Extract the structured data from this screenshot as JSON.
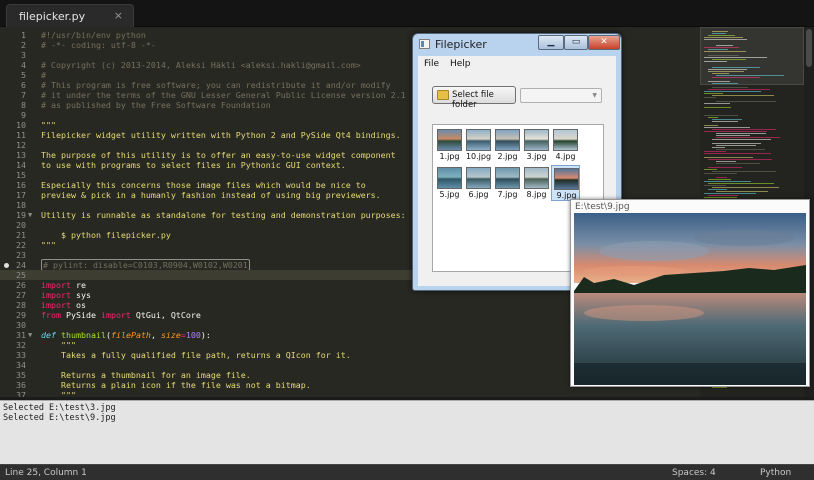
{
  "editor": {
    "tab": {
      "label": "filepicker.py",
      "close": "×"
    },
    "lines": [
      {
        "n": "1",
        "cls": "c-comment",
        "text": "#!/usr/bin/env python"
      },
      {
        "n": "2",
        "cls": "c-comment",
        "text": "# -*- coding: utf-8 -*-"
      },
      {
        "n": "3",
        "cls": "",
        "text": ""
      },
      {
        "n": "4",
        "cls": "c-comment",
        "text": "# Copyright (c) 2013-2014, Aleksi Häkli <aleksi.hakli@gmail.com>"
      },
      {
        "n": "5",
        "cls": "c-comment",
        "text": "#"
      },
      {
        "n": "6",
        "cls": "c-comment",
        "text": "# This program is free software; you can redistribute it and/or modify"
      },
      {
        "n": "7",
        "cls": "c-comment",
        "text": "# it under the terms of the GNU Lesser General Public License version 2.1"
      },
      {
        "n": "8",
        "cls": "c-comment",
        "text": "# as published by the Free Software Foundation"
      },
      {
        "n": "9",
        "cls": "",
        "text": ""
      },
      {
        "n": "10",
        "cls": "c-string",
        "text": "\"\"\""
      },
      {
        "n": "11",
        "cls": "c-string",
        "text": "Filepicker widget utility written with Python 2 and PySide Qt4 bindings."
      },
      {
        "n": "12",
        "cls": "",
        "text": ""
      },
      {
        "n": "13",
        "cls": "c-string",
        "text": "The purpose of this utility is to offer an easy-to-use widget component"
      },
      {
        "n": "14",
        "cls": "c-string",
        "text": "to use with programs to select files in Pythonic GUI context."
      },
      {
        "n": "15",
        "cls": "",
        "text": ""
      },
      {
        "n": "16",
        "cls": "c-string",
        "text": "Especially this concerns those image files which would be nice to"
      },
      {
        "n": "17",
        "cls": "c-string",
        "text": "preview & pick in a humanly fashion instead of using big previewers."
      },
      {
        "n": "18",
        "cls": "",
        "text": ""
      },
      {
        "n": "19",
        "cls": "c-string",
        "fold": "▼",
        "text": "Utility is runnable as standalone for testing and demonstration purposes:"
      },
      {
        "n": "20",
        "cls": "",
        "text": ""
      },
      {
        "n": "21",
        "cls": "c-string",
        "text": "    $ python filepicker.py"
      },
      {
        "n": "22",
        "cls": "c-string",
        "text": "\"\"\""
      },
      {
        "n": "23",
        "cls": "",
        "text": ""
      },
      {
        "n": "24",
        "cls": "c-comment",
        "boxed": true,
        "bookmark": true,
        "text": "# pylint: disable=C0103,R0904,W0102,W0201"
      },
      {
        "n": "25",
        "cls": "",
        "current": true,
        "text": ""
      },
      {
        "n": "26",
        "parts": [
          {
            "c": "c-keyword",
            "t": "import"
          },
          {
            "c": "",
            "t": " re"
          }
        ]
      },
      {
        "n": "27",
        "parts": [
          {
            "c": "c-keyword",
            "t": "import"
          },
          {
            "c": "",
            "t": " sys"
          }
        ]
      },
      {
        "n": "28",
        "parts": [
          {
            "c": "c-keyword",
            "t": "import"
          },
          {
            "c": "",
            "t": " os"
          }
        ]
      },
      {
        "n": "29",
        "parts": [
          {
            "c": "c-keyword",
            "t": "from"
          },
          {
            "c": "",
            "t": " PySide "
          },
          {
            "c": "c-keyword",
            "t": "import"
          },
          {
            "c": "",
            "t": " QtGui, QtCore"
          }
        ]
      },
      {
        "n": "30",
        "cls": "",
        "text": ""
      },
      {
        "n": "31",
        "fold": "▼",
        "parts": [
          {
            "c": "c-def",
            "t": "def"
          },
          {
            "c": "",
            "t": " "
          },
          {
            "c": "c-func",
            "t": "thumbnail"
          },
          {
            "c": "",
            "t": "("
          },
          {
            "c": "c-param",
            "t": "filePath"
          },
          {
            "c": "",
            "t": ", "
          },
          {
            "c": "c-param",
            "t": "size"
          },
          {
            "c": "c-keyword",
            "t": "="
          },
          {
            "c": "c-num",
            "t": "100"
          },
          {
            "c": "",
            "t": "):"
          }
        ]
      },
      {
        "n": "32",
        "cls": "c-string",
        "text": "    \"\"\""
      },
      {
        "n": "33",
        "cls": "c-string",
        "text": "    Takes a fully qualified file path, returns a QIcon for it."
      },
      {
        "n": "34",
        "cls": "",
        "text": ""
      },
      {
        "n": "35",
        "cls": "c-string",
        "text": "    Returns a thumbnail for an image file."
      },
      {
        "n": "36",
        "cls": "c-string",
        "text": "    Returns a plain icon if the file was not a bitmap."
      },
      {
        "n": "37",
        "cls": "c-string",
        "text": "    \"\"\""
      }
    ]
  },
  "output": {
    "lines": [
      "Selected E:\\test\\3.jpg",
      "Selected E:\\test\\9.jpg"
    ]
  },
  "status": {
    "position": "Line 25, Column 1",
    "spaces": "Spaces: 4",
    "language": "Python"
  },
  "filepicker": {
    "title": "Filepicker",
    "menu": [
      "File",
      "Help"
    ],
    "select_button": "Select file folder",
    "combo_value": "",
    "files": [
      {
        "label": "1.jpg",
        "palette": [
          "#6a8cae",
          "#2f4a3a",
          "#c98a62"
        ]
      },
      {
        "label": "10.jpg",
        "palette": [
          "#8fb0c9",
          "#3b5c6e",
          "#d6d1c5"
        ]
      },
      {
        "label": "2.jpg",
        "palette": [
          "#7fa4c2",
          "#304c5a",
          "#c9c0b3"
        ]
      },
      {
        "label": "3.jpg",
        "palette": [
          "#9db6c8",
          "#42605e",
          "#e7e2d8"
        ]
      },
      {
        "label": "4.jpg",
        "palette": [
          "#b2c6d5",
          "#24422d",
          "#dbd7cb"
        ]
      },
      {
        "label": "5.jpg",
        "palette": [
          "#5e8fa8",
          "#2e5766",
          "#7fb0bf"
        ]
      },
      {
        "label": "6.jpg",
        "palette": [
          "#86a9bf",
          "#3a5a62",
          "#b6c7cc"
        ]
      },
      {
        "label": "7.jpg",
        "palette": [
          "#6f98ae",
          "#2b4d58",
          "#9fbac4"
        ]
      },
      {
        "label": "8.jpg",
        "palette": [
          "#a0b8c6",
          "#4b5f55",
          "#cfd5d2"
        ]
      },
      {
        "label": "9.jpg",
        "palette": [
          "#55789a",
          "#1f2d25",
          "#d98a70"
        ],
        "selected": true
      }
    ]
  },
  "preview": {
    "title": "E:\\test\\9.jpg"
  },
  "colors": {
    "editor_bg": "#272822",
    "comment": "#75715e",
    "string": "#e6db74",
    "keyword": "#f92672",
    "function": "#a6e22e",
    "param": "#fd971f"
  }
}
